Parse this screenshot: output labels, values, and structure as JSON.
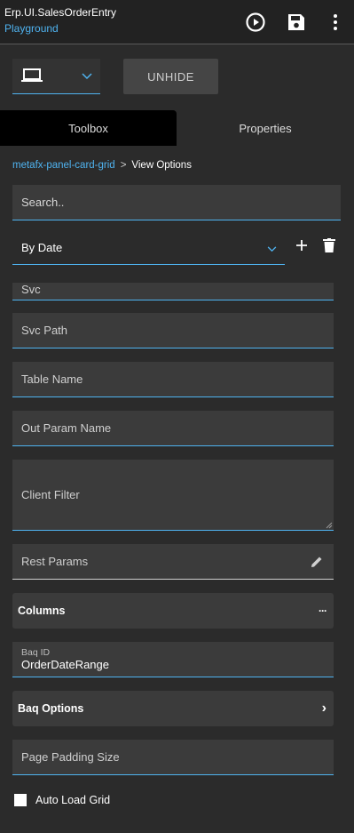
{
  "header": {
    "title": "Erp.UI.SalesOrderEntry",
    "subtitle": "Playground",
    "icons": [
      "play-circle-icon",
      "save-icon",
      "more-vertical-icon"
    ]
  },
  "toolbar": {
    "device_icon": "laptop-icon",
    "unhide_label": "UNHIDE"
  },
  "tabs": [
    {
      "label": "Toolbox",
      "active": true
    },
    {
      "label": "Properties",
      "active": false
    }
  ],
  "breadcrumb": {
    "parent": "metafx-panel-card-grid",
    "separator": ">",
    "current": "View Options"
  },
  "search": {
    "placeholder": "Search.."
  },
  "view_select": {
    "value": "By Date"
  },
  "properties": {
    "svc": "Svc",
    "svc_path": "Svc Path",
    "table_name": "Table Name",
    "out_param_name": "Out Param Name",
    "client_filter": "Client Filter",
    "rest_params": "Rest Params",
    "columns": "Columns",
    "columns_more": "···",
    "baq_id_label": "Baq ID",
    "baq_id_value": "OrderDateRange",
    "baq_options": "Baq Options",
    "baq_options_arrow": "›",
    "page_padding_size": "Page Padding Size",
    "auto_load_grid": "Auto Load Grid"
  },
  "colors": {
    "accent": "#4fb3f0",
    "background": "#2b2b2b",
    "field": "#3b3b3b"
  }
}
